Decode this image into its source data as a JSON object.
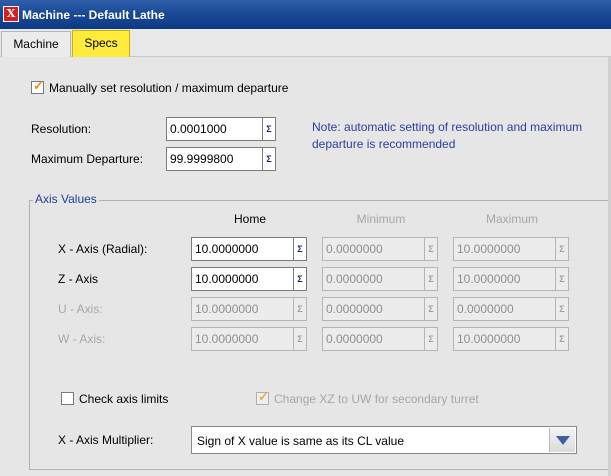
{
  "window": {
    "title": "Machine --- Default Lathe",
    "icon_letter": "X"
  },
  "tabs": [
    {
      "label": "Machine",
      "active": false
    },
    {
      "label": "Specs",
      "active": true
    }
  ],
  "manual": {
    "label": "Manually set resolution / maximum departure",
    "checked": true
  },
  "resolution": {
    "label": "Resolution:",
    "value": "0.0001000"
  },
  "max_departure": {
    "label": "Maximum Departure:",
    "value": "99.9999800"
  },
  "note": "Note:  automatic setting of resolution and maximum departure is recommended",
  "sigma_symbol": "Σ",
  "axis_values": {
    "title": "Axis Values",
    "columns": [
      "Home",
      "Minimum",
      "Maximum"
    ],
    "rows": [
      {
        "label": "X - Axis (Radial):",
        "home": "10.0000000",
        "min": "0.0000000",
        "max": "10.0000000"
      },
      {
        "label": "Z - Axis",
        "home": "10.0000000",
        "min": "0.0000000",
        "max": "10.0000000"
      },
      {
        "label": "U - Axis:",
        "home": "10.0000000",
        "min": "0.0000000",
        "max": "0.0000000"
      },
      {
        "label": "W - Axis:",
        "home": "10.0000000",
        "min": "0.0000000",
        "max": "10.0000000"
      }
    ]
  },
  "check_limits": {
    "label": "Check axis limits",
    "checked": false
  },
  "change_xz": {
    "label": "Change XZ to UW for secondary turret",
    "checked": true
  },
  "multiplier": {
    "label": "X - Axis Multiplier:",
    "value": "Sign of X value is same as its CL value"
  },
  "colors": {
    "accent_tab": "#ffeb3b",
    "note_text": "#2b3f9e",
    "check_tick": "#ee8a10",
    "title_bar": "#1b4a96"
  }
}
